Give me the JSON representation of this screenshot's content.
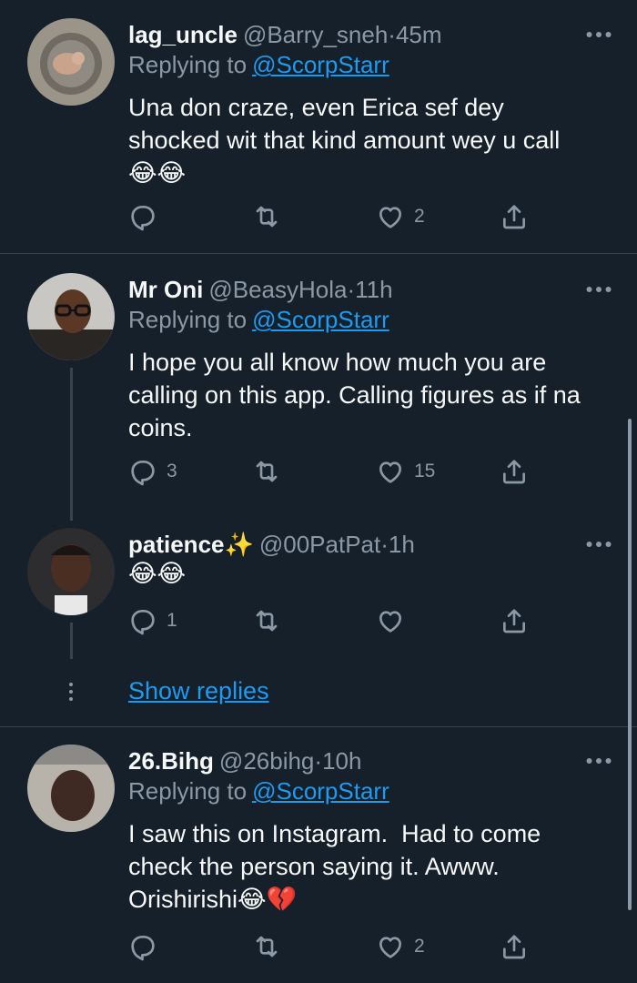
{
  "tweets": [
    {
      "name": "lag_uncle",
      "handle": "@Barry_sneh",
      "dot": "·",
      "time": "45m",
      "replying_label": "Replying to",
      "replying_to": "@ScorpStarr",
      "text": "Una don craze, even Erica sef dey\nshocked wit that kind amount wey u call\n😂😂",
      "reply_count": "",
      "retweet_count": "",
      "like_count": "2"
    },
    {
      "name": "Mr Oni",
      "handle": "@BeasyHola",
      "dot": "·",
      "time": "11h",
      "replying_label": "Replying to",
      "replying_to": "@ScorpStarr",
      "text": "I hope you all know how much you are\ncalling on this app. Calling figures as if na\ncoins.",
      "reply_count": "3",
      "retweet_count": "",
      "like_count": "15"
    },
    {
      "name": "patience✨",
      "handle": "@00PatPat",
      "dot": "·",
      "time": "1h",
      "text": "😂😂",
      "reply_count": "1",
      "retweet_count": "",
      "like_count": ""
    },
    {
      "name": "26.Bihg",
      "handle": "@26bihg",
      "dot": "·",
      "time": "10h",
      "replying_label": "Replying to",
      "replying_to": "@ScorpStarr",
      "text": "I saw this on Instagram.  Had to come\ncheck the person saying it. Awww.\nOrishirishi😂💔",
      "reply_count": "",
      "retweet_count": "",
      "like_count": "2"
    }
  ],
  "show_replies": "Show replies",
  "colors": {
    "background": "#15202b",
    "accent": "#1d9bf0",
    "muted": "#8b98a5",
    "divider": "#38444d"
  },
  "icons": [
    "more-icon",
    "reply-icon",
    "retweet-icon",
    "like-icon",
    "share-icon"
  ]
}
